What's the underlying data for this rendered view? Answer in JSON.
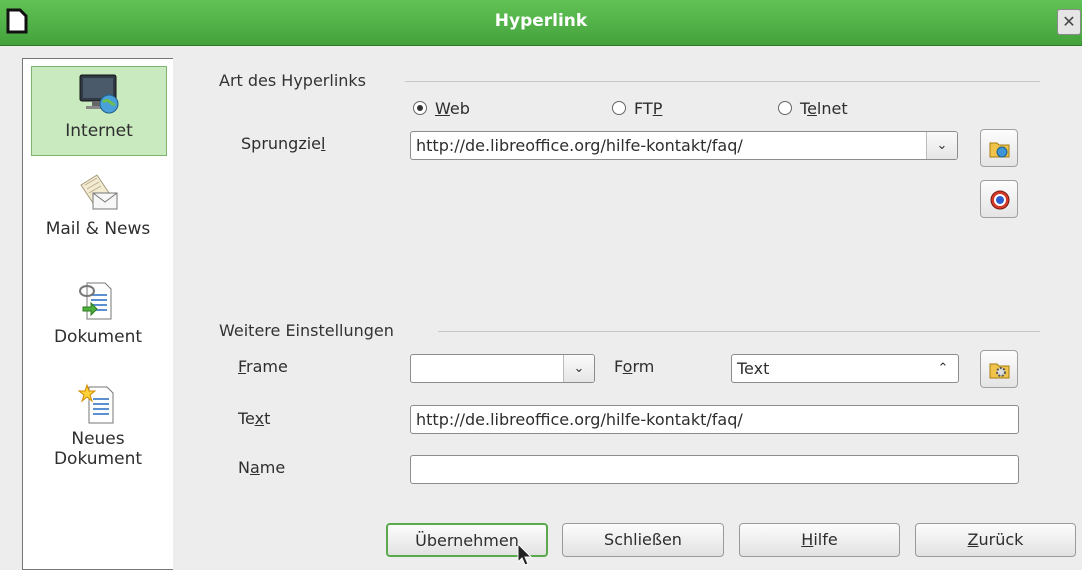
{
  "window": {
    "title": "Hyperlink"
  },
  "sidebar": {
    "items": [
      {
        "label": "Internet",
        "icon": "monitor-globe-icon",
        "selected": true
      },
      {
        "label": "Mail & News",
        "icon": "mail-envelope-icon",
        "selected": false
      },
      {
        "label": "Dokument",
        "icon": "document-link-icon",
        "selected": false
      },
      {
        "label": "Neues Dokument",
        "label_line1": "Neues",
        "label_line2": "Dokument",
        "icon": "new-document-icon",
        "selected": false
      }
    ]
  },
  "hyperlink_type": {
    "title": "Art des Hyperlinks",
    "options": [
      {
        "label": "Web",
        "selected": true
      },
      {
        "label": "FTP",
        "selected": false
      },
      {
        "label": "Telnet",
        "selected": false
      }
    ],
    "target_label": "Sprungziel",
    "target_value": "http://de.libreoffice.org/hilfe-kontakt/faq/"
  },
  "further_settings": {
    "title": "Weitere Einstellungen",
    "frame_label": "Frame",
    "frame_value": "",
    "form_label": "Form",
    "form_value": "Text",
    "text_label": "Text",
    "text_value": "http://de.libreoffice.org/hilfe-kontakt/faq/",
    "name_label": "Name",
    "name_value": ""
  },
  "buttons": {
    "apply": "Übernehmen",
    "close": "Schließen",
    "help": "Hilfe",
    "reset": "Zurück"
  },
  "colors": {
    "titlebar": "#4fb245",
    "selection": "#c9e9be",
    "default_border": "#5aa94d"
  }
}
